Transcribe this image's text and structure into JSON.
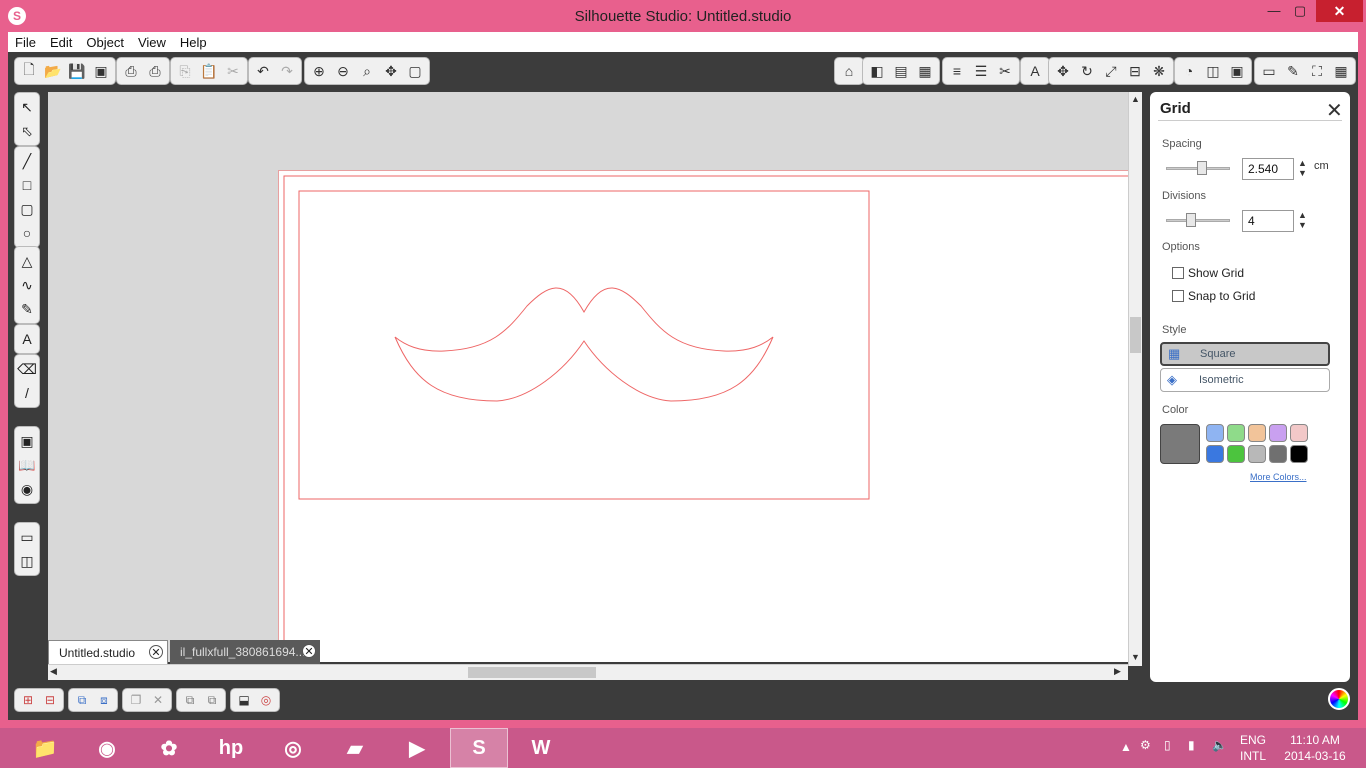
{
  "window": {
    "title": "Silhouette Studio: Untitled.studio",
    "logo": "S",
    "minimize": "—",
    "maximize": "▢",
    "close": "✕"
  },
  "menu": [
    "File",
    "Edit",
    "Object",
    "View",
    "Help"
  ],
  "doc_tabs": [
    {
      "label": "Untitled.studio",
      "active": true
    },
    {
      "label": "il_fullxfull_380861694...",
      "active": false
    }
  ],
  "panel": {
    "title": "Grid",
    "spacing": {
      "label": "Spacing",
      "value": "2.540",
      "unit": "cm",
      "slider_fraction": 0.55
    },
    "divisions": {
      "label": "Divisions",
      "value": "4",
      "slider_fraction": 0.35
    },
    "options": {
      "label": "Options",
      "show_grid": "Show Grid",
      "snap_to_grid": "Snap to Grid"
    },
    "style": {
      "label": "Style",
      "square": "Square",
      "isometric": "Isometric"
    },
    "color": {
      "label": "Color",
      "current": "#7a7a7a",
      "swatches": [
        "#8fb4f2",
        "#8fdb8a",
        "#f2c49a",
        "#c9a0f0",
        "#f2c8c8",
        "#3a78e0",
        "#4cc43e",
        "#b8b8b8",
        "#707070",
        "#000000"
      ],
      "more": "More Colors..."
    }
  },
  "taskbar": {
    "lang_1": "ENG",
    "lang_2": "INTL",
    "time": "11:10 AM",
    "date": "2014-03-16"
  }
}
